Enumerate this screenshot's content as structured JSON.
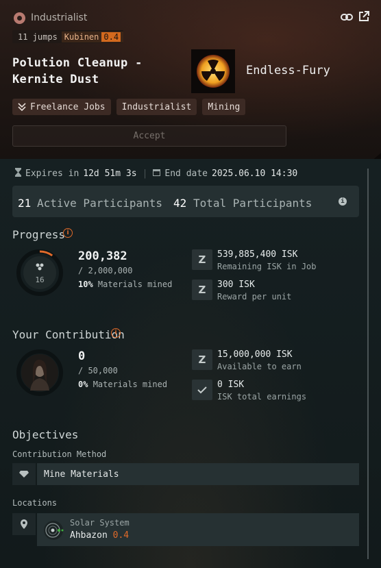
{
  "header": {
    "type_label": "Industrialist",
    "jumps": "11 jumps",
    "system": "Kubinen",
    "system_security": "0.4",
    "title": "Polution Cleanup - Kernite Dust",
    "corporation": "Endless-Fury",
    "tags": [
      "Freelance Jobs",
      "Industrialist",
      "Mining"
    ],
    "accept_label": "Accept",
    "icons": [
      "link-icon",
      "external-link-icon"
    ]
  },
  "timing": {
    "expires_label": "Expires in",
    "expires_value": "12d 51m 3s",
    "end_label": "End date",
    "end_value": "2025.06.10 14:30"
  },
  "participants": {
    "active_count": "21",
    "active_label": "Active Participants",
    "total_count": "42",
    "total_label": "Total Participants"
  },
  "progress": {
    "title": "Progress",
    "ring_count": "16",
    "current": "200,382",
    "target": "/ 2,000,000",
    "percent": "10%",
    "percent_label": "Materials mined",
    "fraction": 0.1,
    "remaining_isk": "539,885,400 ISK",
    "remaining_label": "Remaining ISK in Job",
    "reward": "300 ISK",
    "reward_label": "Reward per unit"
  },
  "contribution": {
    "title": "Your Contribution",
    "current": "0",
    "target": "/ 50,000",
    "percent": "0%",
    "percent_label": "Materials mined",
    "available_isk": "15,000,000 ISK",
    "available_label": "Available to earn",
    "earned_isk": "0 ISK",
    "earned_label": "ISK total earnings"
  },
  "objectives": {
    "title": "Objectives",
    "method_label": "Contribution Method",
    "method_value": "Mine Materials",
    "locations_label": "Locations",
    "location_type": "Solar System",
    "location_name": "Ahbazon",
    "location_security": "0.4"
  },
  "colors": {
    "accent_orange": "#e06a2a",
    "security_low": "#d2691e"
  }
}
